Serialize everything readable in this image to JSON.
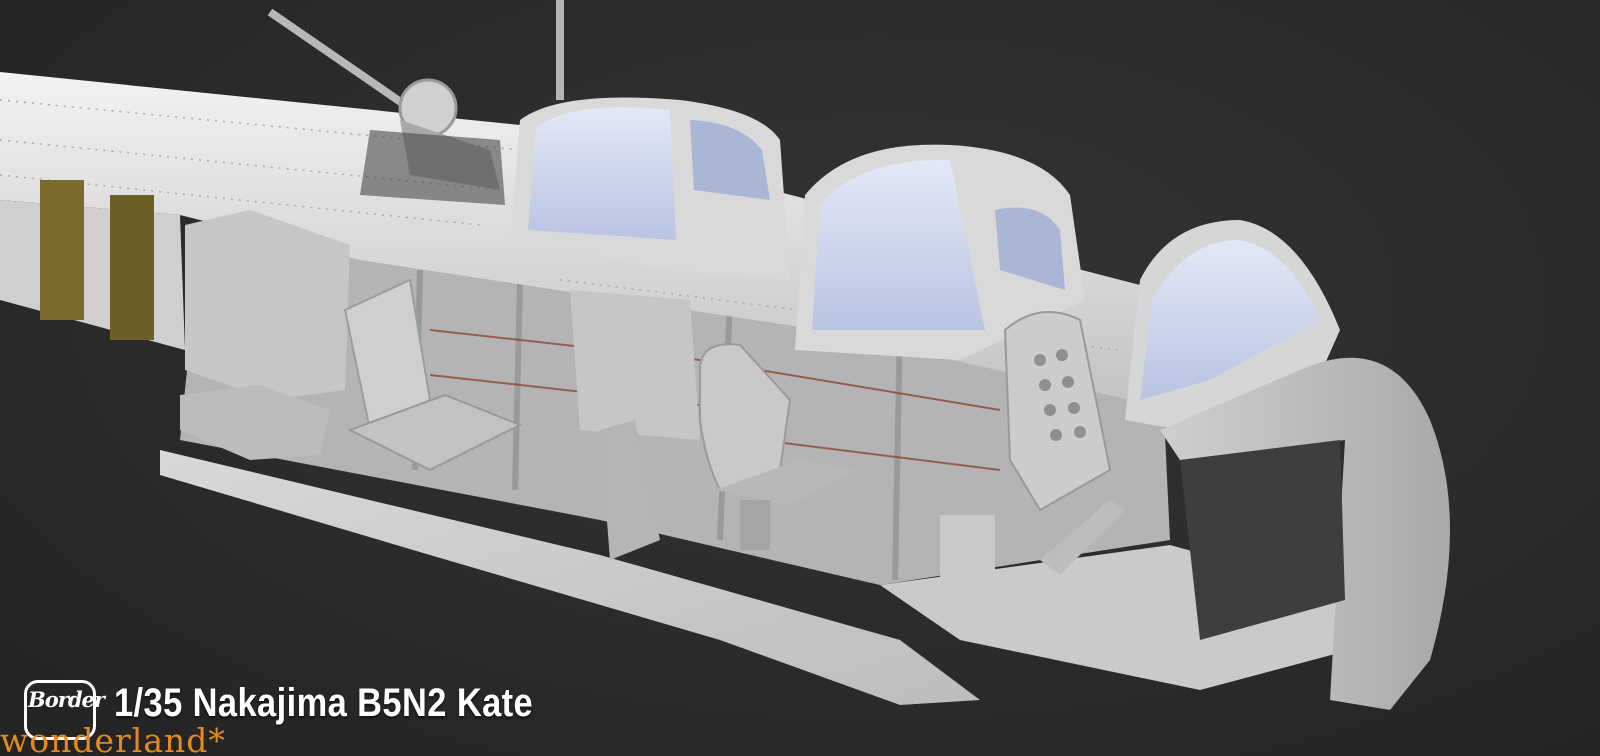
{
  "image": {
    "subject": "cutaway fuselage model",
    "background_color": "#2b2b2c",
    "model_color": "#dcdcdc",
    "canopy_color": "#c9d3ea"
  },
  "caption": {
    "logo_text": "Border",
    "title": "1/35 Nakajima B5N2 Kate",
    "brand": "wonderland*",
    "brand_color": "#e58a1c"
  }
}
